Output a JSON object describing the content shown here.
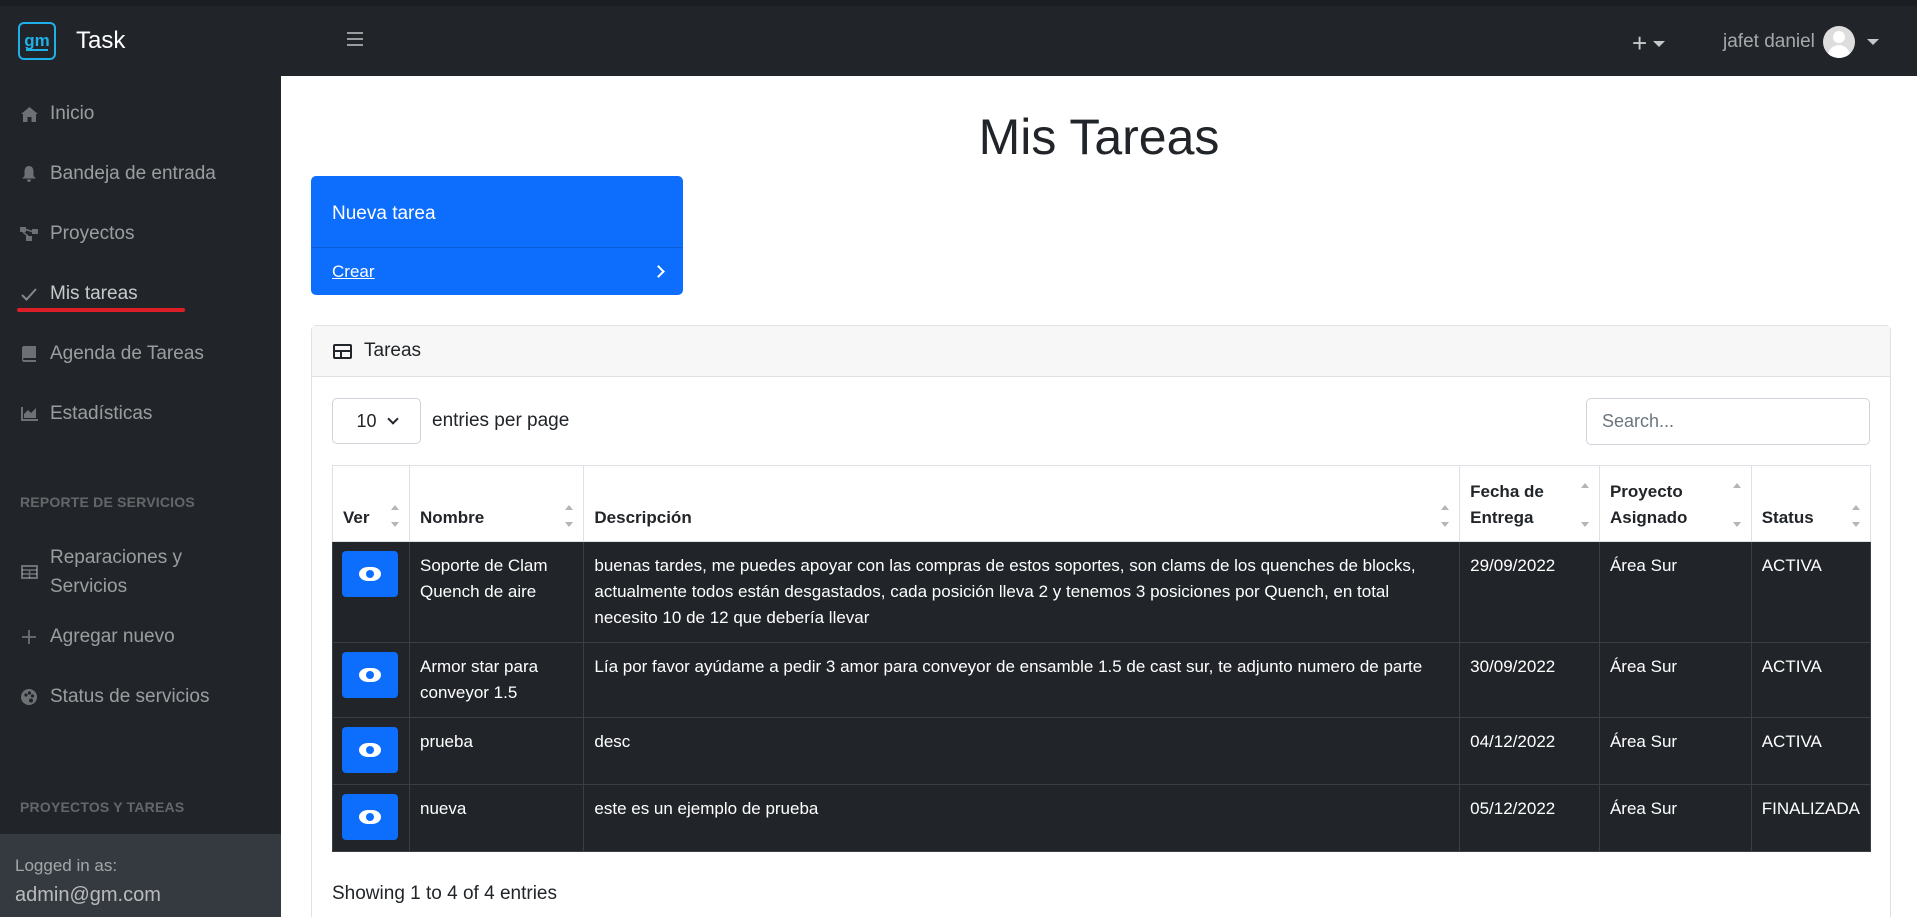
{
  "app": {
    "brand_name": "Task",
    "logo_text": "gm"
  },
  "sidebar": {
    "items": [
      {
        "label": "Inicio",
        "icon": "home-icon"
      },
      {
        "label": "Bandeja de entrada",
        "icon": "bell-icon"
      },
      {
        "label": "Proyectos",
        "icon": "project-diagram-icon"
      },
      {
        "label": "Mis tareas",
        "icon": "check-icon"
      },
      {
        "label": "Agenda de Tareas",
        "icon": "book-icon"
      },
      {
        "label": "Estadísticas",
        "icon": "chart-area-icon"
      }
    ],
    "heading_servicios": "REPORTE DE SERVICIOS",
    "servicios_items": [
      {
        "label": "Reparaciones y Servicios",
        "icon": "table-icon"
      },
      {
        "label": "Agregar nuevo",
        "icon": "plus-icon"
      },
      {
        "label": "Status de servicios",
        "icon": "palette-icon"
      }
    ],
    "heading_proyectos": "PROYECTOS Y TAREAS",
    "footer": {
      "logged_in_label": "Logged in as:",
      "email": "admin@gm.com"
    }
  },
  "topnav": {
    "plus_label": "+",
    "user_name": "jafet daniel"
  },
  "main": {
    "title": "Mis Tareas",
    "new_card": {
      "title": "Nueva tarea",
      "link": "Crear"
    },
    "table_card": {
      "header": "Tareas",
      "entries_value": "10",
      "entries_label": "entries per page",
      "search_placeholder": "Search...",
      "columns": [
        "Ver",
        "Nombre",
        "Descripción",
        "Fecha de Entrega",
        "Proyecto Asignado",
        "Status"
      ],
      "rows": [
        {
          "nombre": "Soporte de Clam Quench de aire",
          "descripcion": "buenas tardes, me puedes apoyar con las compras de estos soportes, son clams de los quenches de blocks, actualmente todos están desgastados, cada posición lleva 2 y tenemos 3 posiciones por Quench, en total necesito 10 de 12 que debería llevar",
          "fecha": "29/09/2022",
          "proyecto": "Área Sur",
          "status": "ACTIVA"
        },
        {
          "nombre": "Armor star para conveyor 1.5",
          "descripcion": "Lía por favor ayúdame a pedir 3 amor para conveyor de ensamble 1.5 de cast sur, te adjunto numero de parte",
          "fecha": "30/09/2022",
          "proyecto": "Área Sur",
          "status": "ACTIVA"
        },
        {
          "nombre": "prueba",
          "descripcion": "desc",
          "fecha": "04/12/2022",
          "proyecto": "Área Sur",
          "status": "ACTIVA"
        },
        {
          "nombre": "nueva",
          "descripcion": "este es un ejemplo de prueba",
          "fecha": "05/12/2022",
          "proyecto": "Área Sur",
          "status": "FINALIZADA"
        }
      ],
      "showing": "Showing 1 to 4 of 4 entries"
    }
  },
  "colors": {
    "primary": "#0d6efd",
    "sidebar_bg": "#212529",
    "active_underline": "#dc1f26"
  }
}
